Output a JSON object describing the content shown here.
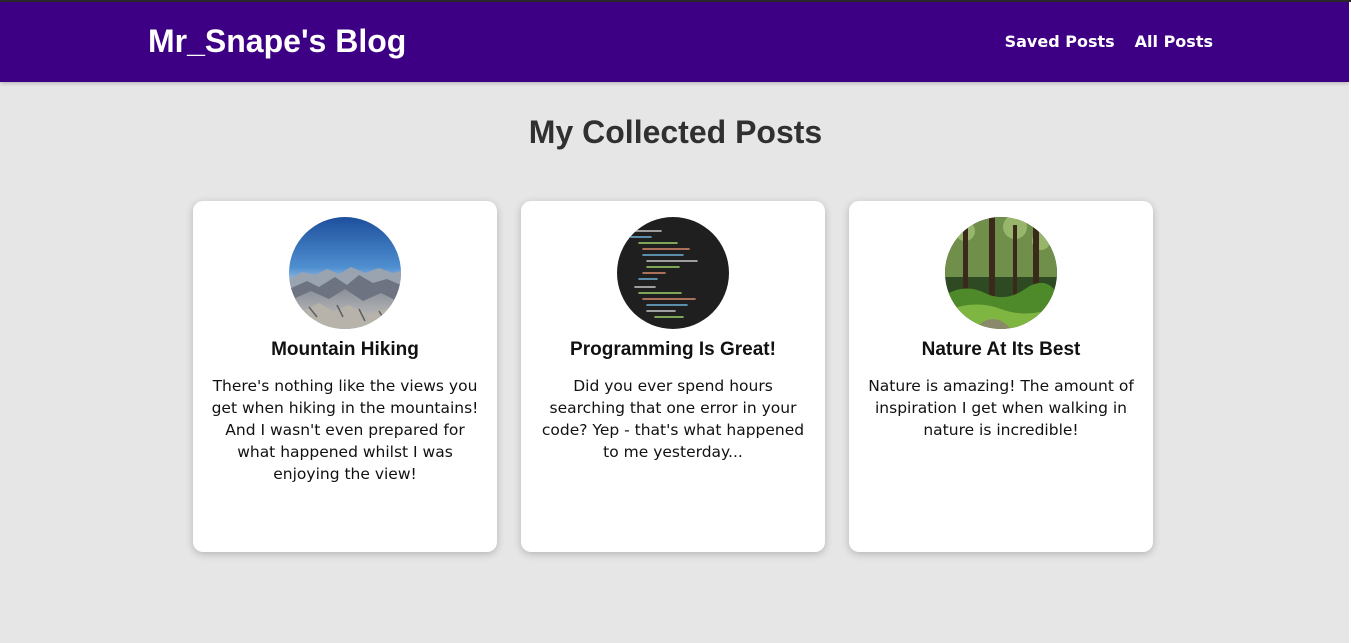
{
  "header": {
    "brand": "Mr_Snape's Blog",
    "nav": [
      {
        "label": "Saved Posts"
      },
      {
        "label": "All Posts"
      }
    ],
    "background": "#3d0084"
  },
  "main": {
    "title": "My Collected Posts",
    "posts": [
      {
        "title": "Mountain Hiking",
        "excerpt": "There's nothing like the views you get when hiking in the mountains! And I wasn't even prepared for what happened whilst I was enjoying the view!",
        "image": "mountain-photo"
      },
      {
        "title": "Programming Is Great!",
        "excerpt": "Did you ever spend hours searching that one error in your code? Yep - that's what happened to me yesterday...",
        "image": "code-photo"
      },
      {
        "title": "Nature At Its Best",
        "excerpt": "Nature is amazing! The amount of inspiration I get when walking in nature is incredible!",
        "image": "forest-photo"
      }
    ]
  }
}
